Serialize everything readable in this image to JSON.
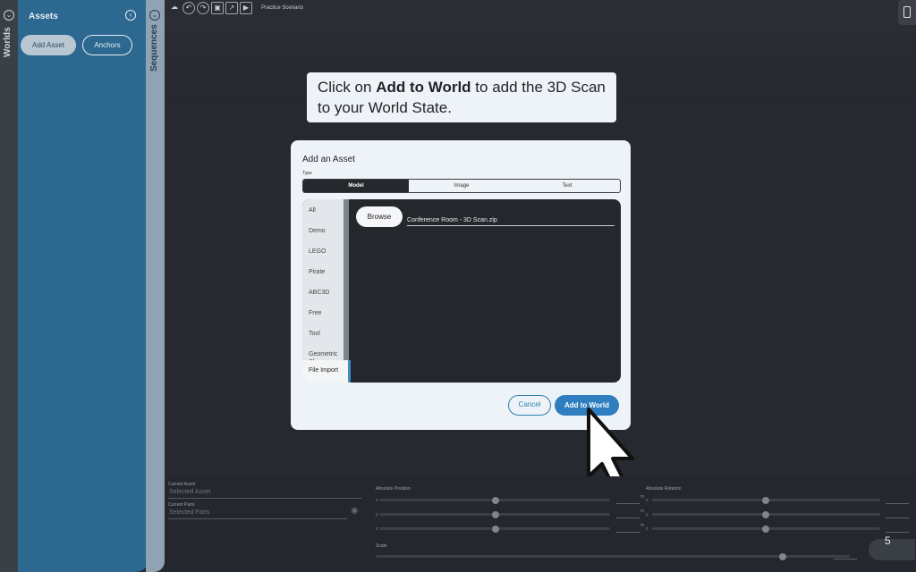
{
  "sidebar": {
    "worlds_label": "Worlds",
    "assets_title": "Assets",
    "add_asset_label": "Add Asset",
    "anchors_label": "Anchors",
    "sequences_label": "Sequences"
  },
  "toolbar": {
    "scenario_label": "Practice Scenario"
  },
  "callout": {
    "part1": "Click on ",
    "bold": "Add to World",
    "part2": " to add the 3D Scan to your World State."
  },
  "modal": {
    "title": "Add an Asset",
    "type_label": "Type",
    "type_tabs": [
      "Model",
      "Image",
      "Text"
    ],
    "categories": [
      "All",
      "Demo",
      "LEGO",
      "Pirate",
      "ABC3D",
      "Free",
      "Tool",
      "Geometric Shapes"
    ],
    "file_import_label": "File Import",
    "browse_label": "Browse",
    "file_name": "Conference Room - 3D Scan.zip",
    "cancel_label": "Cancel",
    "add_label": "Add to World"
  },
  "bottom_panel": {
    "current_asset_label": "Current Asset",
    "current_asset_value": "Selected Asset",
    "current_parts_label": "Current Parts",
    "current_parts_value": "Selected Parts",
    "absolute_position_label": "Absolute Position",
    "absolute_rotation_label": "Absolute Rotation",
    "scale_label": "Scale",
    "axes": [
      "x",
      "y",
      "z"
    ],
    "unit": "m"
  },
  "page_number": "5"
}
